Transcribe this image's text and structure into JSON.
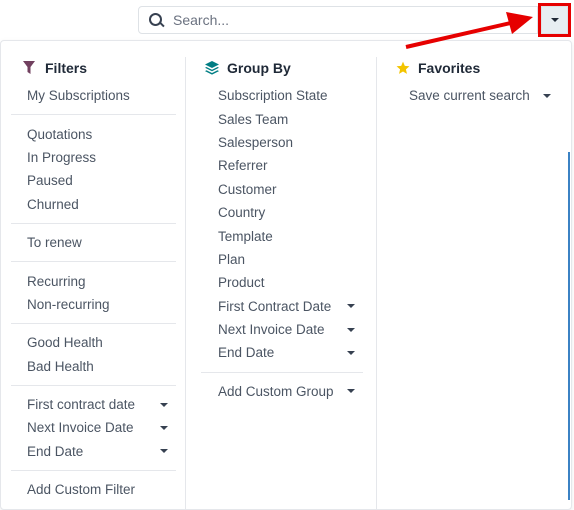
{
  "search": {
    "placeholder": "Search...",
    "value": ""
  },
  "icons": {
    "search": "search-icon",
    "toggle": "caret-down-icon",
    "filters": "filter-icon",
    "groupby": "layers-icon",
    "favorites": "star-icon"
  },
  "colors": {
    "filter_icon": "#71405f",
    "groupby_icon": "#017e84",
    "favorite_icon": "#f3c400",
    "highlight": "#e60000",
    "accent_line": "#3b82c4"
  },
  "filters": {
    "title": "Filters",
    "groups": [
      [
        {
          "label": "My Subscriptions",
          "has_caret": false
        }
      ],
      [
        {
          "label": "Quotations",
          "has_caret": false
        },
        {
          "label": "In Progress",
          "has_caret": false
        },
        {
          "label": "Paused",
          "has_caret": false
        },
        {
          "label": "Churned",
          "has_caret": false
        }
      ],
      [
        {
          "label": "To renew",
          "has_caret": false
        }
      ],
      [
        {
          "label": "Recurring",
          "has_caret": false
        },
        {
          "label": "Non-recurring",
          "has_caret": false
        }
      ],
      [
        {
          "label": "Good Health",
          "has_caret": false
        },
        {
          "label": "Bad Health",
          "has_caret": false
        }
      ],
      [
        {
          "label": "First contract date",
          "has_caret": true
        },
        {
          "label": "Next Invoice Date",
          "has_caret": true
        },
        {
          "label": "End Date",
          "has_caret": true
        }
      ],
      [
        {
          "label": "Add Custom Filter",
          "has_caret": false
        }
      ]
    ]
  },
  "groupby": {
    "title": "Group By",
    "groups": [
      [
        {
          "label": "Subscription State",
          "has_caret": false
        },
        {
          "label": "Sales Team",
          "has_caret": false
        },
        {
          "label": "Salesperson",
          "has_caret": false
        },
        {
          "label": "Referrer",
          "has_caret": false
        },
        {
          "label": "Customer",
          "has_caret": false
        },
        {
          "label": "Country",
          "has_caret": false
        },
        {
          "label": "Template",
          "has_caret": false
        },
        {
          "label": "Plan",
          "has_caret": false
        },
        {
          "label": "Product",
          "has_caret": false
        },
        {
          "label": "First Contract Date",
          "has_caret": true
        },
        {
          "label": "Next Invoice Date",
          "has_caret": true
        },
        {
          "label": "End Date",
          "has_caret": true
        }
      ],
      [
        {
          "label": "Add Custom Group",
          "has_caret": true
        }
      ]
    ]
  },
  "favorites": {
    "title": "Favorites",
    "groups": [
      [
        {
          "label": "Save current search",
          "has_caret": true
        }
      ]
    ]
  }
}
